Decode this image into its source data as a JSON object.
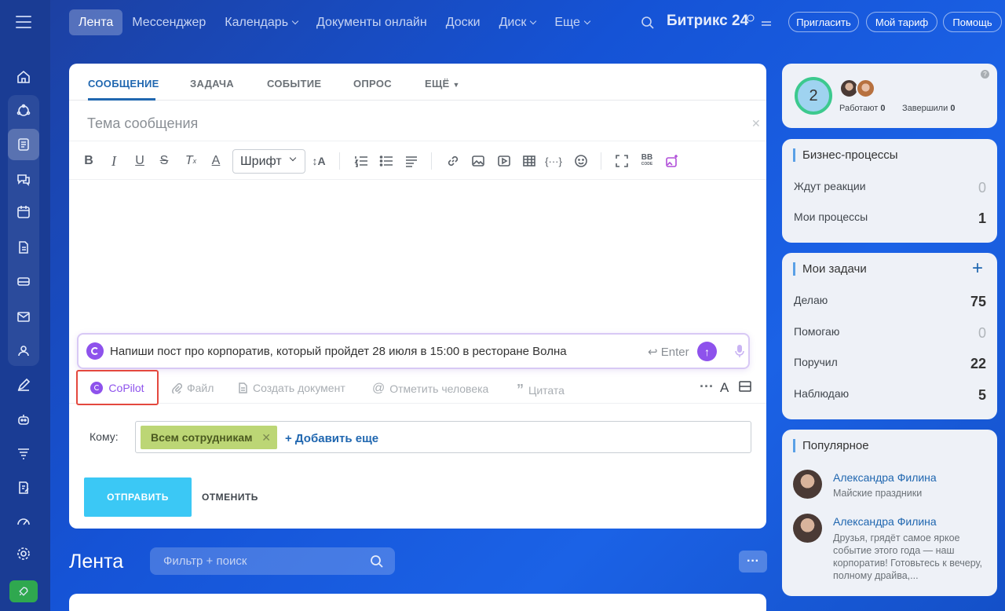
{
  "top_nav": {
    "items": [
      "Лента",
      "Мессенджер",
      "Календарь",
      "Документы онлайн",
      "Доски",
      "Диск",
      "Еще"
    ],
    "brand": "Битрикс 24",
    "invite": "Пригласить",
    "tariff": "Мой тариф",
    "help": "Помощь"
  },
  "post_form": {
    "tabs": [
      "СООБЩЕНИЕ",
      "ЗАДАЧА",
      "СОБЫТИЕ",
      "ОПРОС",
      "ЕЩЁ"
    ],
    "subject_placeholder": "Тема сообщения",
    "font_select": "Шрифт",
    "copilot_prompt": "Напиши пост про корпоратив, который пройдет 28 июля в 15:00 в ресторане Волна",
    "enter_hint": "Enter",
    "bottom_actions": {
      "copilot": "CoPilot",
      "file": "Файл",
      "create_doc": "Создать документ",
      "mention": "Отметить человека",
      "quote": "Цитата"
    },
    "to_label": "Кому:",
    "recipient": "Всем сотрудникам",
    "add_more": "+ Добавить еще",
    "send": "ОТПРАВИТЬ",
    "cancel": "ОТМЕНИТЬ"
  },
  "feed": {
    "title": "Лента",
    "filter_placeholder": "Фильтр + поиск"
  },
  "right": {
    "team": {
      "count": "2",
      "working_label": "Работают",
      "working": "0",
      "done_label": "Завершили",
      "done": "0"
    },
    "bp": {
      "title": "Бизнес-процессы",
      "rows": [
        {
          "label": "Ждут реакции",
          "value": "0"
        },
        {
          "label": "Мои процессы",
          "value": "1"
        }
      ]
    },
    "tasks": {
      "title": "Мои задачи",
      "add": "+",
      "rows": [
        {
          "label": "Делаю",
          "value": "75"
        },
        {
          "label": "Помогаю",
          "value": "0"
        },
        {
          "label": "Поручил",
          "value": "22"
        },
        {
          "label": "Наблюдаю",
          "value": "5"
        }
      ]
    },
    "popular": {
      "title": "Популярное",
      "items": [
        {
          "name": "Александра Филина",
          "text": "Майские праздники"
        },
        {
          "name": "Александра Филина",
          "text": "Друзья, грядёт самое яркое событие этого года — наш корпоратив! Готовьтесь к вечеру, полному драйва,..."
        }
      ]
    }
  },
  "colors": {
    "accent": "#2067b0",
    "copilot": "#8e52ec",
    "send": "#3bc8f5",
    "highlight": "#e4483e"
  }
}
